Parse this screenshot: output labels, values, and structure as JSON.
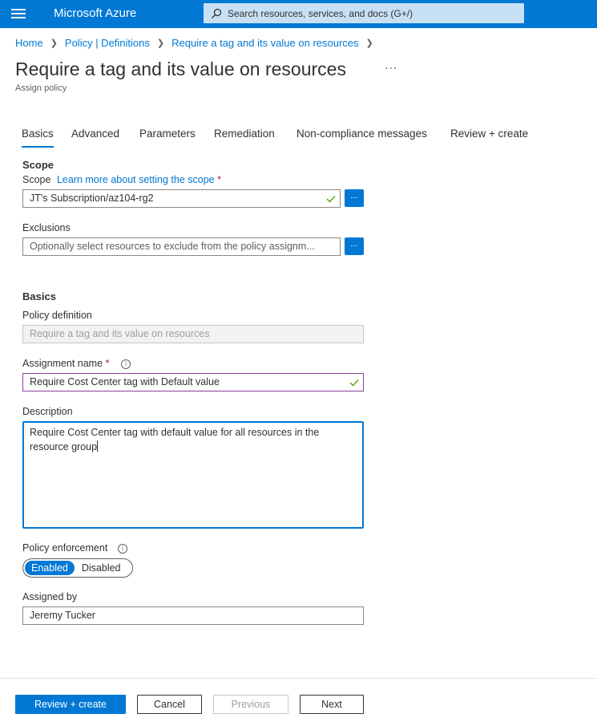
{
  "topbar": {
    "brand": "Microsoft Azure",
    "search_placeholder": "Search resources, services, and docs (G+/)"
  },
  "breadcrumb": [
    "Home",
    "Policy | Definitions",
    "Require a tag and its value on resources"
  ],
  "page": {
    "title": "Require a tag and its value on resources",
    "subtitle": "Assign policy",
    "more_label": "···"
  },
  "tabs": [
    "Basics",
    "Advanced",
    "Parameters",
    "Remediation",
    "Non-compliance messages",
    "Review + create"
  ],
  "scope_section": {
    "heading": "Scope",
    "scope_label": "Scope",
    "scope_link": "Learn more about setting the scope",
    "required_mark": "*",
    "scope_value": "JT's Subscription/az104-rg2",
    "browse_label": "...",
    "exclusions_label": "Exclusions",
    "exclusions_placeholder": "Optionally select resources to exclude from the policy assignm..."
  },
  "basics_section": {
    "heading": "Basics",
    "policy_definition_label": "Policy definition",
    "policy_definition_value": "Require a tag and its value on resources",
    "assignment_name_label": "Assignment name",
    "assignment_name_value": "Require Cost Center tag with Default value",
    "description_label": "Description",
    "description_value": "Require Cost Center tag with default value for all resources in the resource group",
    "policy_enforcement_label": "Policy enforcement",
    "enforcement_options": [
      "Enabled",
      "Disabled"
    ],
    "enforcement_selected": "Enabled",
    "assigned_by_label": "Assigned by",
    "assigned_by_value": "Jeremy Tucker",
    "info_glyph": "i"
  },
  "footer": {
    "review_create": "Review + create",
    "cancel": "Cancel",
    "previous": "Previous",
    "next": "Next"
  },
  "colors": {
    "accent": "#0078d4",
    "valid_check": "#57a300",
    "required": "#a4262c"
  },
  "icons": [
    "hamburger-menu-icon",
    "search-icon",
    "chevron-right-icon",
    "checkmark-icon",
    "info-icon"
  ]
}
